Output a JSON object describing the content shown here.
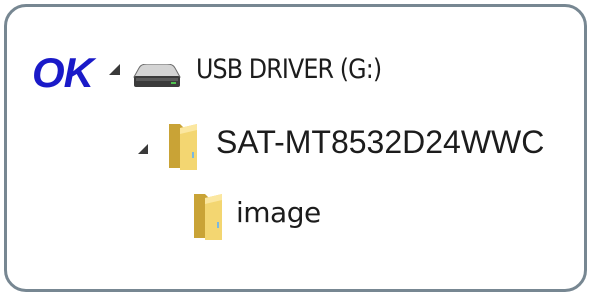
{
  "status": {
    "ok_label": "OK"
  },
  "tree": {
    "drive": {
      "label": "USB DRIVER (G:)",
      "icon": "drive-icon",
      "expanded": true
    },
    "folder": {
      "label": "SAT-MT8532D24WWC",
      "icon": "folder-icon",
      "expanded": true
    },
    "subfolder": {
      "label": "image",
      "icon": "folder-icon"
    }
  },
  "colors": {
    "frame_border": "#778792",
    "ok_text": "#1a1ac8",
    "folder_yellow": "#e8c24a"
  }
}
